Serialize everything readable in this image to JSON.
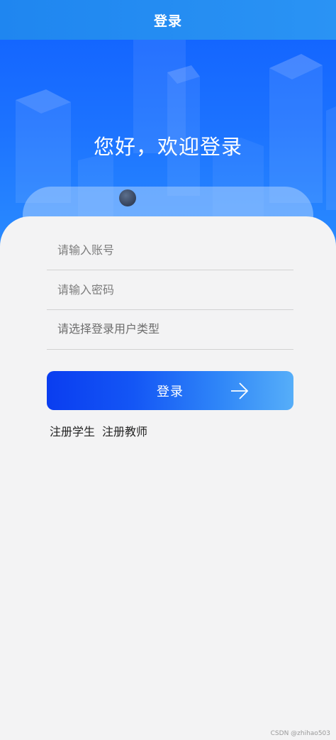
{
  "nav": {
    "title": "登录"
  },
  "hero": {
    "greeting": "您好，欢迎登录"
  },
  "form": {
    "account_placeholder": "请输入账号",
    "password_placeholder": "请输入密码",
    "user_type_placeholder": "请选择登录用户类型"
  },
  "actions": {
    "login_label": "登录",
    "register_student": "注册学生",
    "register_teacher": "注册教师"
  },
  "watermark": "CSDN @zhihao503",
  "icons": {
    "login_arrow": "arrow-right-icon"
  },
  "colors": {
    "nav": "#1f86f0",
    "hero_top": "#1466ff",
    "button_start": "#0a3df0",
    "button_end": "#56aef9",
    "panel": "#f3f3f4"
  }
}
